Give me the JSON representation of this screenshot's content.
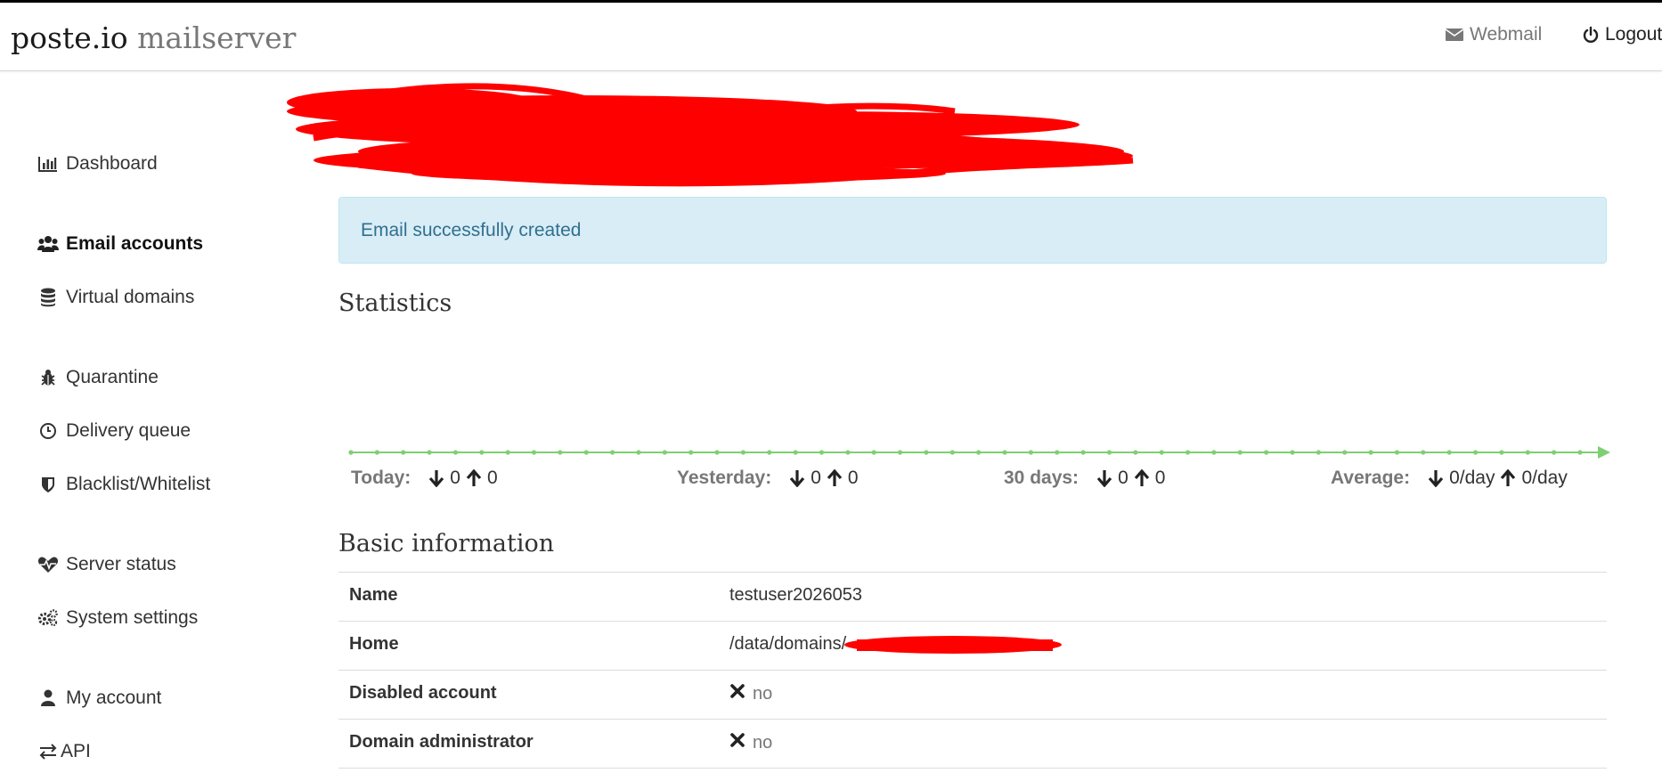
{
  "app": {
    "brand": "poste.io",
    "brand_sub": "mailserver"
  },
  "topnav": {
    "webmail": "Webmail",
    "logout": "Logout"
  },
  "sidebar": {
    "items": [
      {
        "label": "Dashboard",
        "icon": "bar-chart-icon"
      },
      {
        "label": "Email accounts",
        "icon": "users-icon",
        "active": true
      },
      {
        "label": "Virtual domains",
        "icon": "database-icon"
      },
      {
        "label": "Quarantine",
        "icon": "bug-icon"
      },
      {
        "label": "Delivery queue",
        "icon": "clock-icon"
      },
      {
        "label": "Blacklist/Whitelist",
        "icon": "shield-icon"
      },
      {
        "label": "Server status",
        "icon": "heartbeat-icon"
      },
      {
        "label": "System settings",
        "icon": "cogs-icon"
      },
      {
        "label": "My account",
        "icon": "user-icon"
      },
      {
        "label": "API",
        "icon": "exchange-icon"
      }
    ]
  },
  "alert": {
    "message": "Email successfully created",
    "color": "#d9edf7"
  },
  "statistics": {
    "heading": "Statistics",
    "line_color": "#7fcf73",
    "today": {
      "label": "Today:",
      "received": "0",
      "sent": "0"
    },
    "yesterday": {
      "label": "Yesterday:",
      "received": "0",
      "sent": "0"
    },
    "days30": {
      "label": "30 days:",
      "received": "0",
      "sent": "0"
    },
    "average": {
      "label": "Average:",
      "received": "0/day",
      "sent": "0/day"
    }
  },
  "chart_data": {
    "type": "line",
    "points": 48,
    "values": [
      0,
      0,
      0,
      0,
      0,
      0,
      0,
      0,
      0,
      0,
      0,
      0,
      0,
      0,
      0,
      0,
      0,
      0,
      0,
      0,
      0,
      0,
      0,
      0,
      0,
      0,
      0,
      0,
      0,
      0,
      0,
      0,
      0,
      0,
      0,
      0,
      0,
      0,
      0,
      0,
      0,
      0,
      0,
      0,
      0,
      0,
      0,
      0
    ],
    "title": "",
    "xlabel": "",
    "ylabel": ""
  },
  "basic_info": {
    "heading": "Basic information",
    "rows": [
      {
        "key": "Name",
        "value": "testuser2026053"
      },
      {
        "key": "Home",
        "value": "/data/domains/"
      },
      {
        "key": "Disabled account",
        "value": "no"
      },
      {
        "key": "Domain administrator",
        "value": "no"
      }
    ]
  }
}
